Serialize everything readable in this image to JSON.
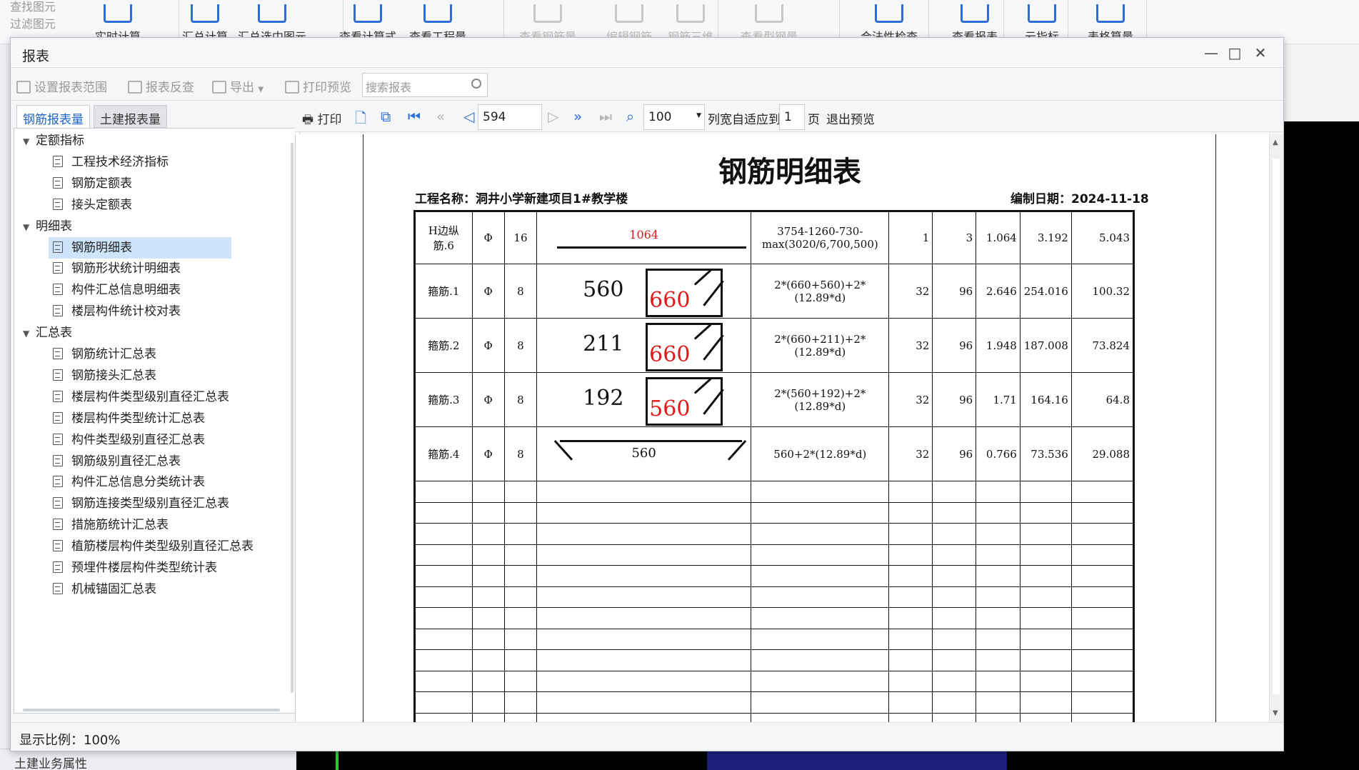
{
  "ribbon": {
    "left_items": [
      "查找图元",
      "过滤图元"
    ],
    "buttons": [
      "实时计算",
      "汇总计算",
      "汇总选中图元",
      "查看计算式",
      "查看工程量",
      "查看钢筋量",
      "编辑钢筋",
      "钢筋三维",
      "查看型钢量",
      "合法性检查",
      "查看报表",
      "云指标",
      "表格算量"
    ],
    "disabled": [
      false,
      false,
      false,
      false,
      false,
      true,
      true,
      true,
      true,
      false,
      false,
      false,
      false
    ]
  },
  "background": {
    "left_bottom_label": "土建业务属性"
  },
  "dialog": {
    "title": "报表",
    "minimize": "—",
    "maximize": "□",
    "close": "✕",
    "toolbar": {
      "set_range": "设置报表范围",
      "reverse_check": "报表反查",
      "export": "导出",
      "print_preview": "打印预览",
      "search_placeholder": "搜索报表"
    },
    "tabs": [
      "钢筋报表量",
      "土建报表量"
    ],
    "tree": [
      {
        "label": "定额指标",
        "type": "group"
      },
      {
        "label": "工程技术经济指标",
        "type": "item"
      },
      {
        "label": "钢筋定额表",
        "type": "item"
      },
      {
        "label": "接头定额表",
        "type": "item"
      },
      {
        "label": "明细表",
        "type": "group"
      },
      {
        "label": "钢筋明细表",
        "type": "item",
        "selected": true
      },
      {
        "label": "钢筋形状统计明细表",
        "type": "item"
      },
      {
        "label": "构件汇总信息明细表",
        "type": "item"
      },
      {
        "label": "楼层构件统计校对表",
        "type": "item"
      },
      {
        "label": "汇总表",
        "type": "group"
      },
      {
        "label": "钢筋统计汇总表",
        "type": "item"
      },
      {
        "label": "钢筋接头汇总表",
        "type": "item"
      },
      {
        "label": "楼层构件类型级别直径汇总表",
        "type": "item"
      },
      {
        "label": "楼层构件类型统计汇总表",
        "type": "item"
      },
      {
        "label": "构件类型级别直径汇总表",
        "type": "item"
      },
      {
        "label": "钢筋级别直径汇总表",
        "type": "item"
      },
      {
        "label": "构件汇总信息分类统计表",
        "type": "item"
      },
      {
        "label": "钢筋连接类型级别直径汇总表",
        "type": "item"
      },
      {
        "label": "措施筋统计汇总表",
        "type": "item"
      },
      {
        "label": "植筋楼层构件类型级别直径汇总表",
        "type": "item"
      },
      {
        "label": "预埋件楼层构件类型统计表",
        "type": "item"
      },
      {
        "label": "机械锚固汇总表",
        "type": "item"
      }
    ],
    "preview_toolbar": {
      "print": "打印",
      "page": "594",
      "zoom": "100",
      "fit_label": "列宽自适应到",
      "fit_pages": "1",
      "pages_unit": "页",
      "exit": "退出预览"
    },
    "status": "显示比例：100%"
  },
  "report": {
    "title": "钢筋明细表",
    "project": "工程名称：洞井小学新建项目1#教学楼",
    "date": "编制日期：2024-11-18",
    "rows": [
      {
        "name": "H边纵筋.6",
        "grade": "Φ",
        "dia": "16",
        "shape": "line",
        "len_a": "1064",
        "formula": "3754-1260-730-max(3020/6,700,500)",
        "count1": "1",
        "count2": "3",
        "unit_w": "1.064",
        "len_total": "3.192",
        "weight": "5.043"
      },
      {
        "name": "箍筋.1",
        "grade": "Φ",
        "dia": "8",
        "shape": "box",
        "len_a": "560",
        "len_b": "660",
        "formula": "2*(660+560)+2*(12.89*d)",
        "count1": "32",
        "count2": "96",
        "unit_w": "2.646",
        "len_total": "254.016",
        "weight": "100.32"
      },
      {
        "name": "箍筋.2",
        "grade": "Φ",
        "dia": "8",
        "shape": "box",
        "len_a": "211",
        "len_b": "660",
        "formula": "2*(660+211)+2*(12.89*d)",
        "count1": "32",
        "count2": "96",
        "unit_w": "1.948",
        "len_total": "187.008",
        "weight": "73.824"
      },
      {
        "name": "箍筋.3",
        "grade": "Φ",
        "dia": "8",
        "shape": "box",
        "len_a": "192",
        "len_b": "560",
        "formula": "2*(560+192)+2*(12.89*d)",
        "count1": "32",
        "count2": "96",
        "unit_w": "1.71",
        "len_total": "164.16",
        "weight": "64.8"
      },
      {
        "name": "箍筋.4",
        "grade": "Φ",
        "dia": "8",
        "shape": "hook",
        "len_a": "560",
        "formula": "560+2*(12.89*d)",
        "count1": "32",
        "count2": "96",
        "unit_w": "0.766",
        "len_total": "73.536",
        "weight": "29.088"
      }
    ],
    "empty_rows": 12
  }
}
